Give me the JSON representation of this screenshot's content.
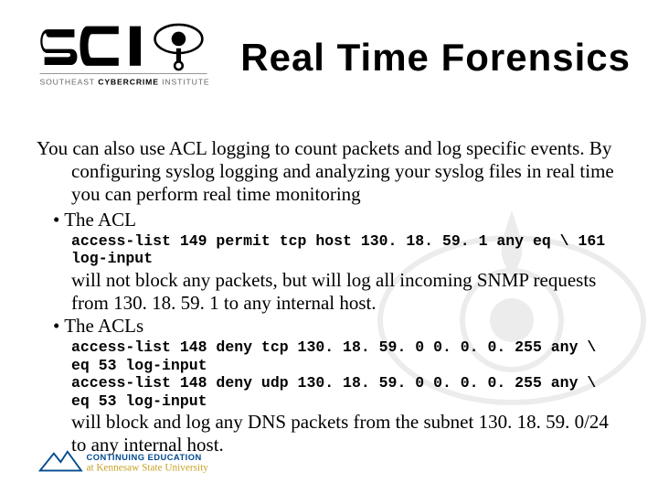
{
  "top_logo": {
    "org_line1": "SOUTHEAST",
    "org_line2_strong": "CYBERCRIME",
    "org_line3": "INSTITUTE"
  },
  "title": "Real Time Forensics",
  "intro": "You can also use ACL logging to count packets and log specific events. By configuring syslog logging and analyzing your syslog files in real time you can perform real time monitoring",
  "bullet1": "The ACL",
  "code1": "access-list 149 permit tcp host 130. 18. 59. 1 any eq \\ 161 log-input",
  "after1": "will not block any packets, but will log all incoming SNMP requests from 130. 18. 59. 1 to any internal host.",
  "bullet2": "The ACLs",
  "code2": "access-list 148 deny tcp 130. 18. 59. 0 0. 0. 0. 255 any \\ eq 53 log-input\naccess-list 148 deny udp 130. 18. 59. 0 0. 0. 0. 255 any \\ eq 53 log-input",
  "after2": "will block and log any DNS packets from the subnet 130. 18. 59. 0/24 to any internal host.",
  "footer": {
    "line1": "CONTINUING EDUCATION",
    "line2": "at Kennesaw State University"
  }
}
